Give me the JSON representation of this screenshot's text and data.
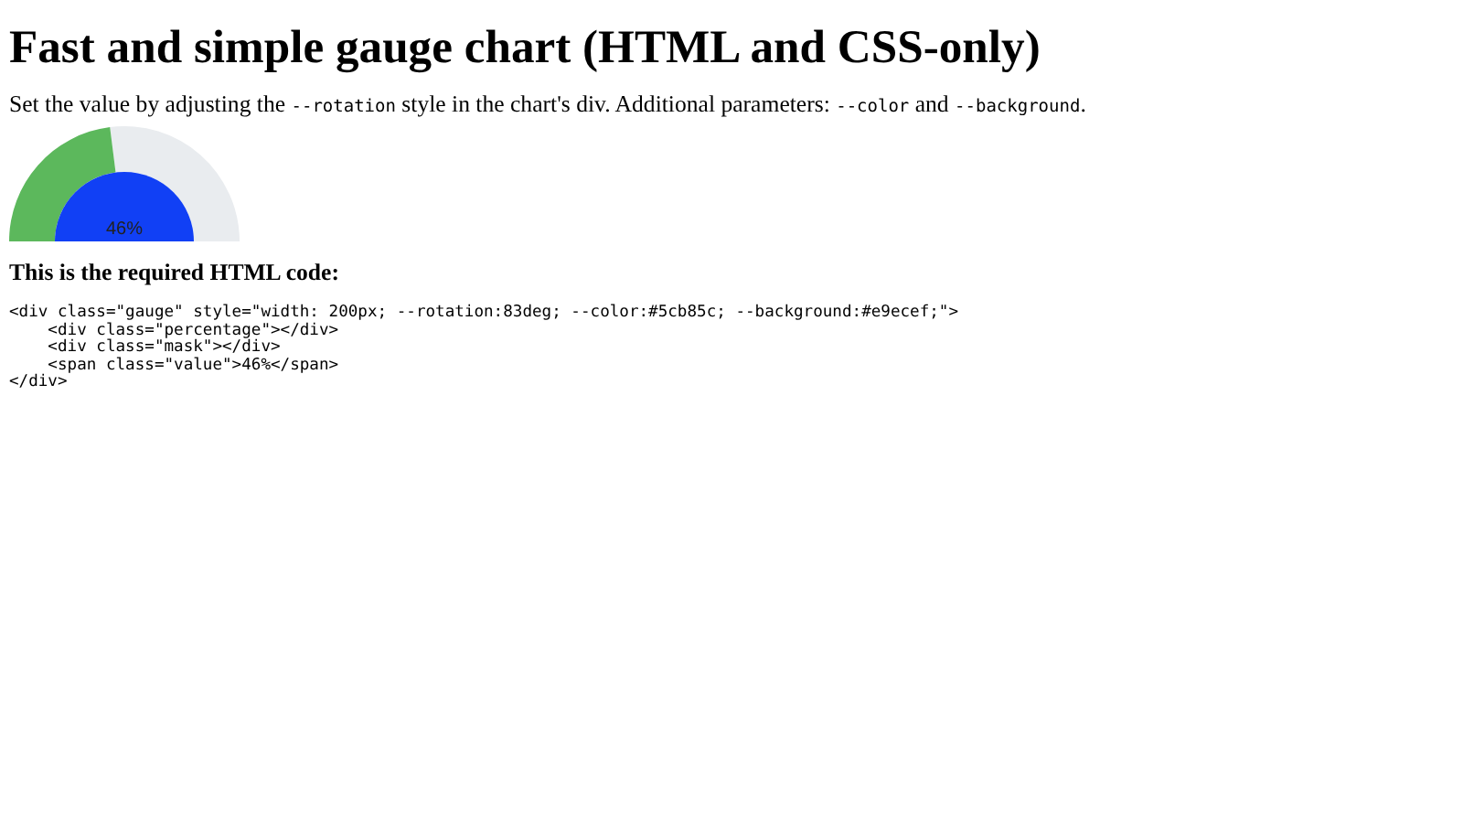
{
  "title": "Fast and simple gauge chart (HTML and CSS-only)",
  "description": [
    {
      "kind": "text",
      "text": "Set the value by adjusting the "
    },
    {
      "kind": "code",
      "text": "--rotation"
    },
    {
      "kind": "text",
      "text": " style in the chart's div. Additional parameters: "
    },
    {
      "kind": "code",
      "text": "--color"
    },
    {
      "kind": "text",
      "text": " and "
    },
    {
      "kind": "code",
      "text": "--background"
    },
    {
      "kind": "text",
      "text": "."
    }
  ],
  "gauge": {
    "level": 0.46,
    "value": "46%"
  },
  "code_heading": "This is the required HTML code:",
  "code_lines": [
    "<div class=\"gauge\" style=\"width: 200px; --rotation:83deg; --color:#5cb85c; --background:#e9ecef;\">",
    "    <div class=\"percentage\"></div>",
    "    <div class=\"mask\"></div>",
    "    <span class=\"value\">46%</span>",
    "</div>"
  ]
}
